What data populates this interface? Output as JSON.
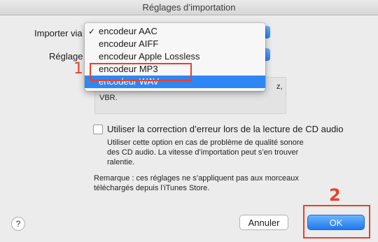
{
  "window": {
    "title": "Réglages d’importation"
  },
  "form": {
    "import_label": "Importer via",
    "setting_label": "Réglage",
    "description_line1": "z,",
    "description_line2": "VBR."
  },
  "menu": {
    "items": [
      {
        "label": "encodeur AAC",
        "checked": true,
        "highlighted": false
      },
      {
        "label": "encodeur AIFF",
        "checked": false,
        "highlighted": false
      },
      {
        "label": "encodeur Apple Lossless",
        "checked": false,
        "highlighted": false
      },
      {
        "label": "encodeur MP3",
        "checked": false,
        "highlighted": false
      },
      {
        "label": "encodeur WAV",
        "checked": false,
        "highlighted": true
      }
    ],
    "check_glyph": "✓"
  },
  "error_correction": {
    "checked": false,
    "label": "Utiliser la correction d’erreur lors de la lecture de CD audio",
    "help_line1": "Utiliser cette option en cas de problème de qualité sonore",
    "help_line2": "des CD audio. La vitesse d’importation peut s’en trouver",
    "help_line3": "ralentie."
  },
  "note": {
    "line1": "Remarque : ces réglages ne s’appliquent pas aux morceaux",
    "line2": "téléchargés depuis l’iTunes Store."
  },
  "buttons": {
    "help": "?",
    "cancel": "Annuler",
    "ok": "OK"
  },
  "annotations": {
    "step1": "1",
    "step2": "2",
    "color": "#e8412b"
  },
  "colors": {
    "accent": "#2f86f5",
    "window_bg": "#ececec"
  }
}
